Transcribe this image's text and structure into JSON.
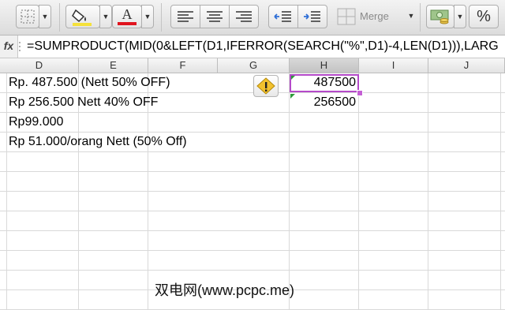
{
  "toolbar": {
    "merge_label": "Merge",
    "percent_label": "%",
    "font_color_letter": "A",
    "fill_color": "#f5e13a",
    "font_color": "#e0141e",
    "icons": [
      "borders-icon",
      "fill-color-icon",
      "font-color-icon",
      "align-left-icon",
      "align-center-icon",
      "align-right-icon",
      "decrease-indent-icon",
      "increase-indent-icon",
      "merge-icon",
      "currency-icon",
      "percent-icon"
    ]
  },
  "formula_bar": {
    "fx_label": "fx",
    "formula": "=SUMPRODUCT(MID(0&LEFT(D1,IFERROR(SEARCH(\"%\",D1)-4,LEN(D1))),LARG"
  },
  "columns": [
    "D",
    "E",
    "F",
    "G",
    "H",
    "I",
    "J"
  ],
  "active_column": "H",
  "cells": {
    "d1": "Rp. 487.500 (Nett 50% OFF)",
    "d2": "Rp 256.500 Nett 40% OFF",
    "d3": "Rp99.000",
    "d4": "Rp 51.000/orang Nett (50% Off)",
    "h1": "487500",
    "h2": "256500"
  },
  "warning": {
    "icon": "warning-icon",
    "color": "#f2c12e"
  },
  "selection_color": "#b44ac9",
  "watermark": "双电网(www.pcpc.me)"
}
